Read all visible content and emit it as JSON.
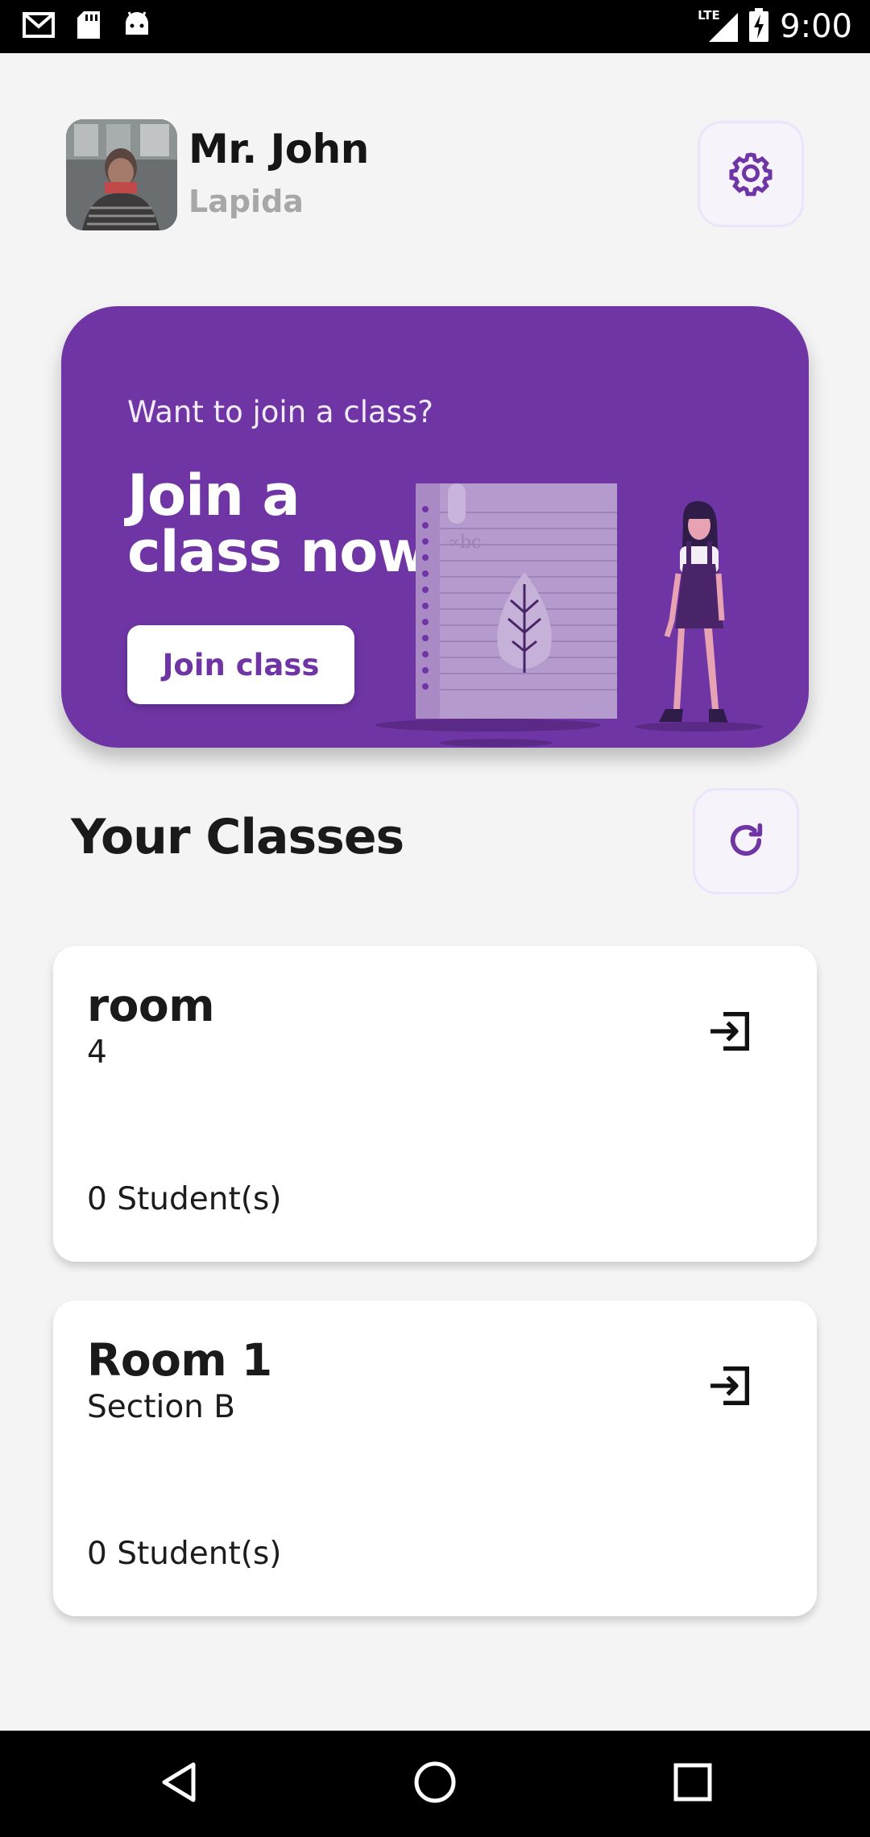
{
  "status_bar": {
    "time": "9:00",
    "network": "LTE",
    "left_icons": [
      "gmail-icon",
      "sd-card-icon",
      "android-icon"
    ],
    "right_icons": [
      "signal-icon",
      "battery-charging-icon"
    ]
  },
  "profile": {
    "first_line": "Mr. John",
    "second_line": "Lapida",
    "settings_icon": "gear-icon"
  },
  "banner": {
    "subtitle": "Want to join a class?",
    "title": "Join a class now",
    "button_label": "Join class",
    "illustration_text": "∝bc"
  },
  "classes_section": {
    "title": "Your Classes",
    "refresh_icon": "refresh-icon"
  },
  "classes": [
    {
      "name": "room",
      "section": "4",
      "students": "0 Student(s)"
    },
    {
      "name": "Room 1",
      "section": "Section B",
      "students": "0 Student(s)"
    }
  ],
  "nav_bar": {
    "buttons": [
      "back-icon",
      "home-icon",
      "recents-icon"
    ]
  },
  "colors": {
    "accent": "#6f35a5",
    "background": "#f4f4f4",
    "card": "#ffffff"
  }
}
